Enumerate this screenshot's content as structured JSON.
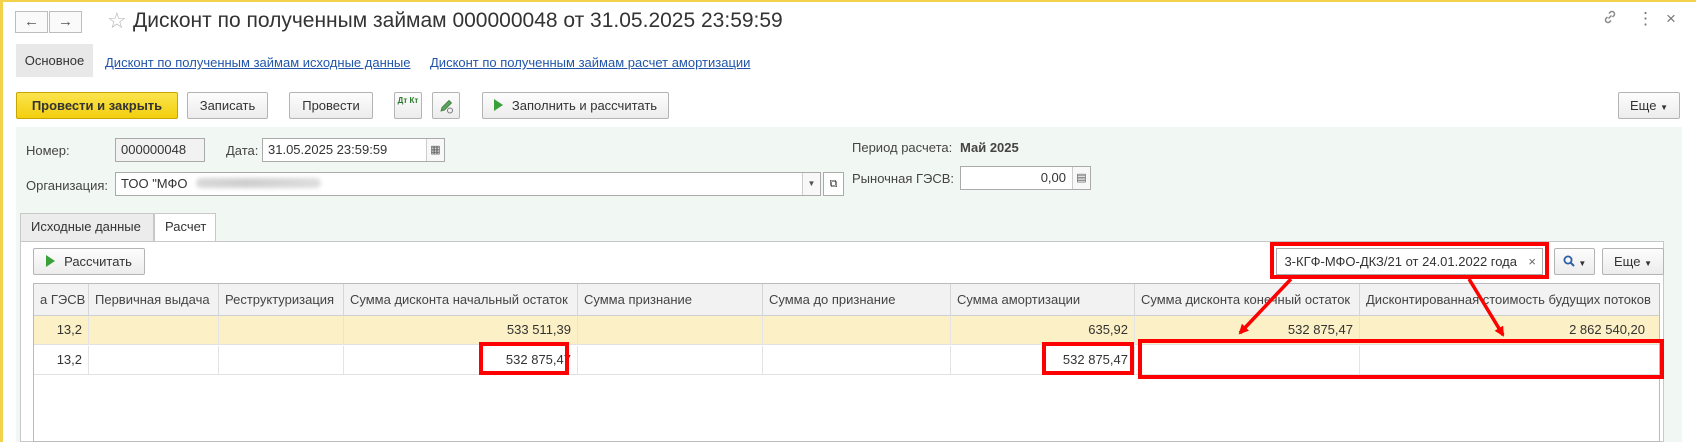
{
  "window": {
    "title": "Дисконт по полученным займам 000000048 от 31.05.2025 23:59:59",
    "back_glyph": "←",
    "forward_glyph": "→",
    "star_glyph": "☆",
    "link_glyph": "🔗",
    "more_glyph": "⋮",
    "close_glyph": "×"
  },
  "nav_links": {
    "main": "Основное",
    "source_data": "Дисконт по полученным займам исходные данные",
    "amortization": "Дисконт по полученным займам расчет амортизации"
  },
  "toolbar": {
    "post_close": "Провести и закрыть",
    "save": "Записать",
    "post": "Провести",
    "dt_kt_glyph": "Дт Кт",
    "fill_calc": "Заполнить и рассчитать",
    "more": "Еще"
  },
  "form": {
    "number_label": "Номер:",
    "number_value": "000000048",
    "date_label": "Дата:",
    "date_value": "31.05.2025 23:59:59",
    "period_label": "Период расчета:",
    "period_value": "Май 2025",
    "org_label": "Организация:",
    "org_value": "ТОО \"МФО",
    "market_rate_label": "Рыночная ГЭСВ:",
    "market_rate_value": "0,00"
  },
  "tabs": [
    "Исходные данные",
    "Расчет"
  ],
  "calc": {
    "calc_button": "Рассчитать",
    "search_value": "3-КГФ-МФО-ДКЗ/21 от 24.01.2022 года",
    "clear_glyph": "×",
    "search_glyph": "🔍",
    "more": "Еще"
  },
  "table": {
    "columns": [
      "а ГЭСВ",
      "Первичная выдача",
      "Реструктуризация",
      "Сумма дисконта начальный остаток",
      "Сумма признание",
      "Сумма до признание",
      "Сумма амортизации",
      "Сумма дисконта конечный остаток",
      "Дисконтированная стоимость будущих потоков"
    ],
    "rows": [
      [
        "13,2",
        "",
        "",
        "533 511,39",
        "",
        "",
        "635,92",
        "532 875,47",
        "2 862 540,20"
      ],
      [
        "13,2",
        "",
        "",
        "532 875,47",
        "",
        "",
        "532 875,47",
        "",
        ""
      ]
    ]
  },
  "annotation": {
    "color": "#ff0000"
  }
}
